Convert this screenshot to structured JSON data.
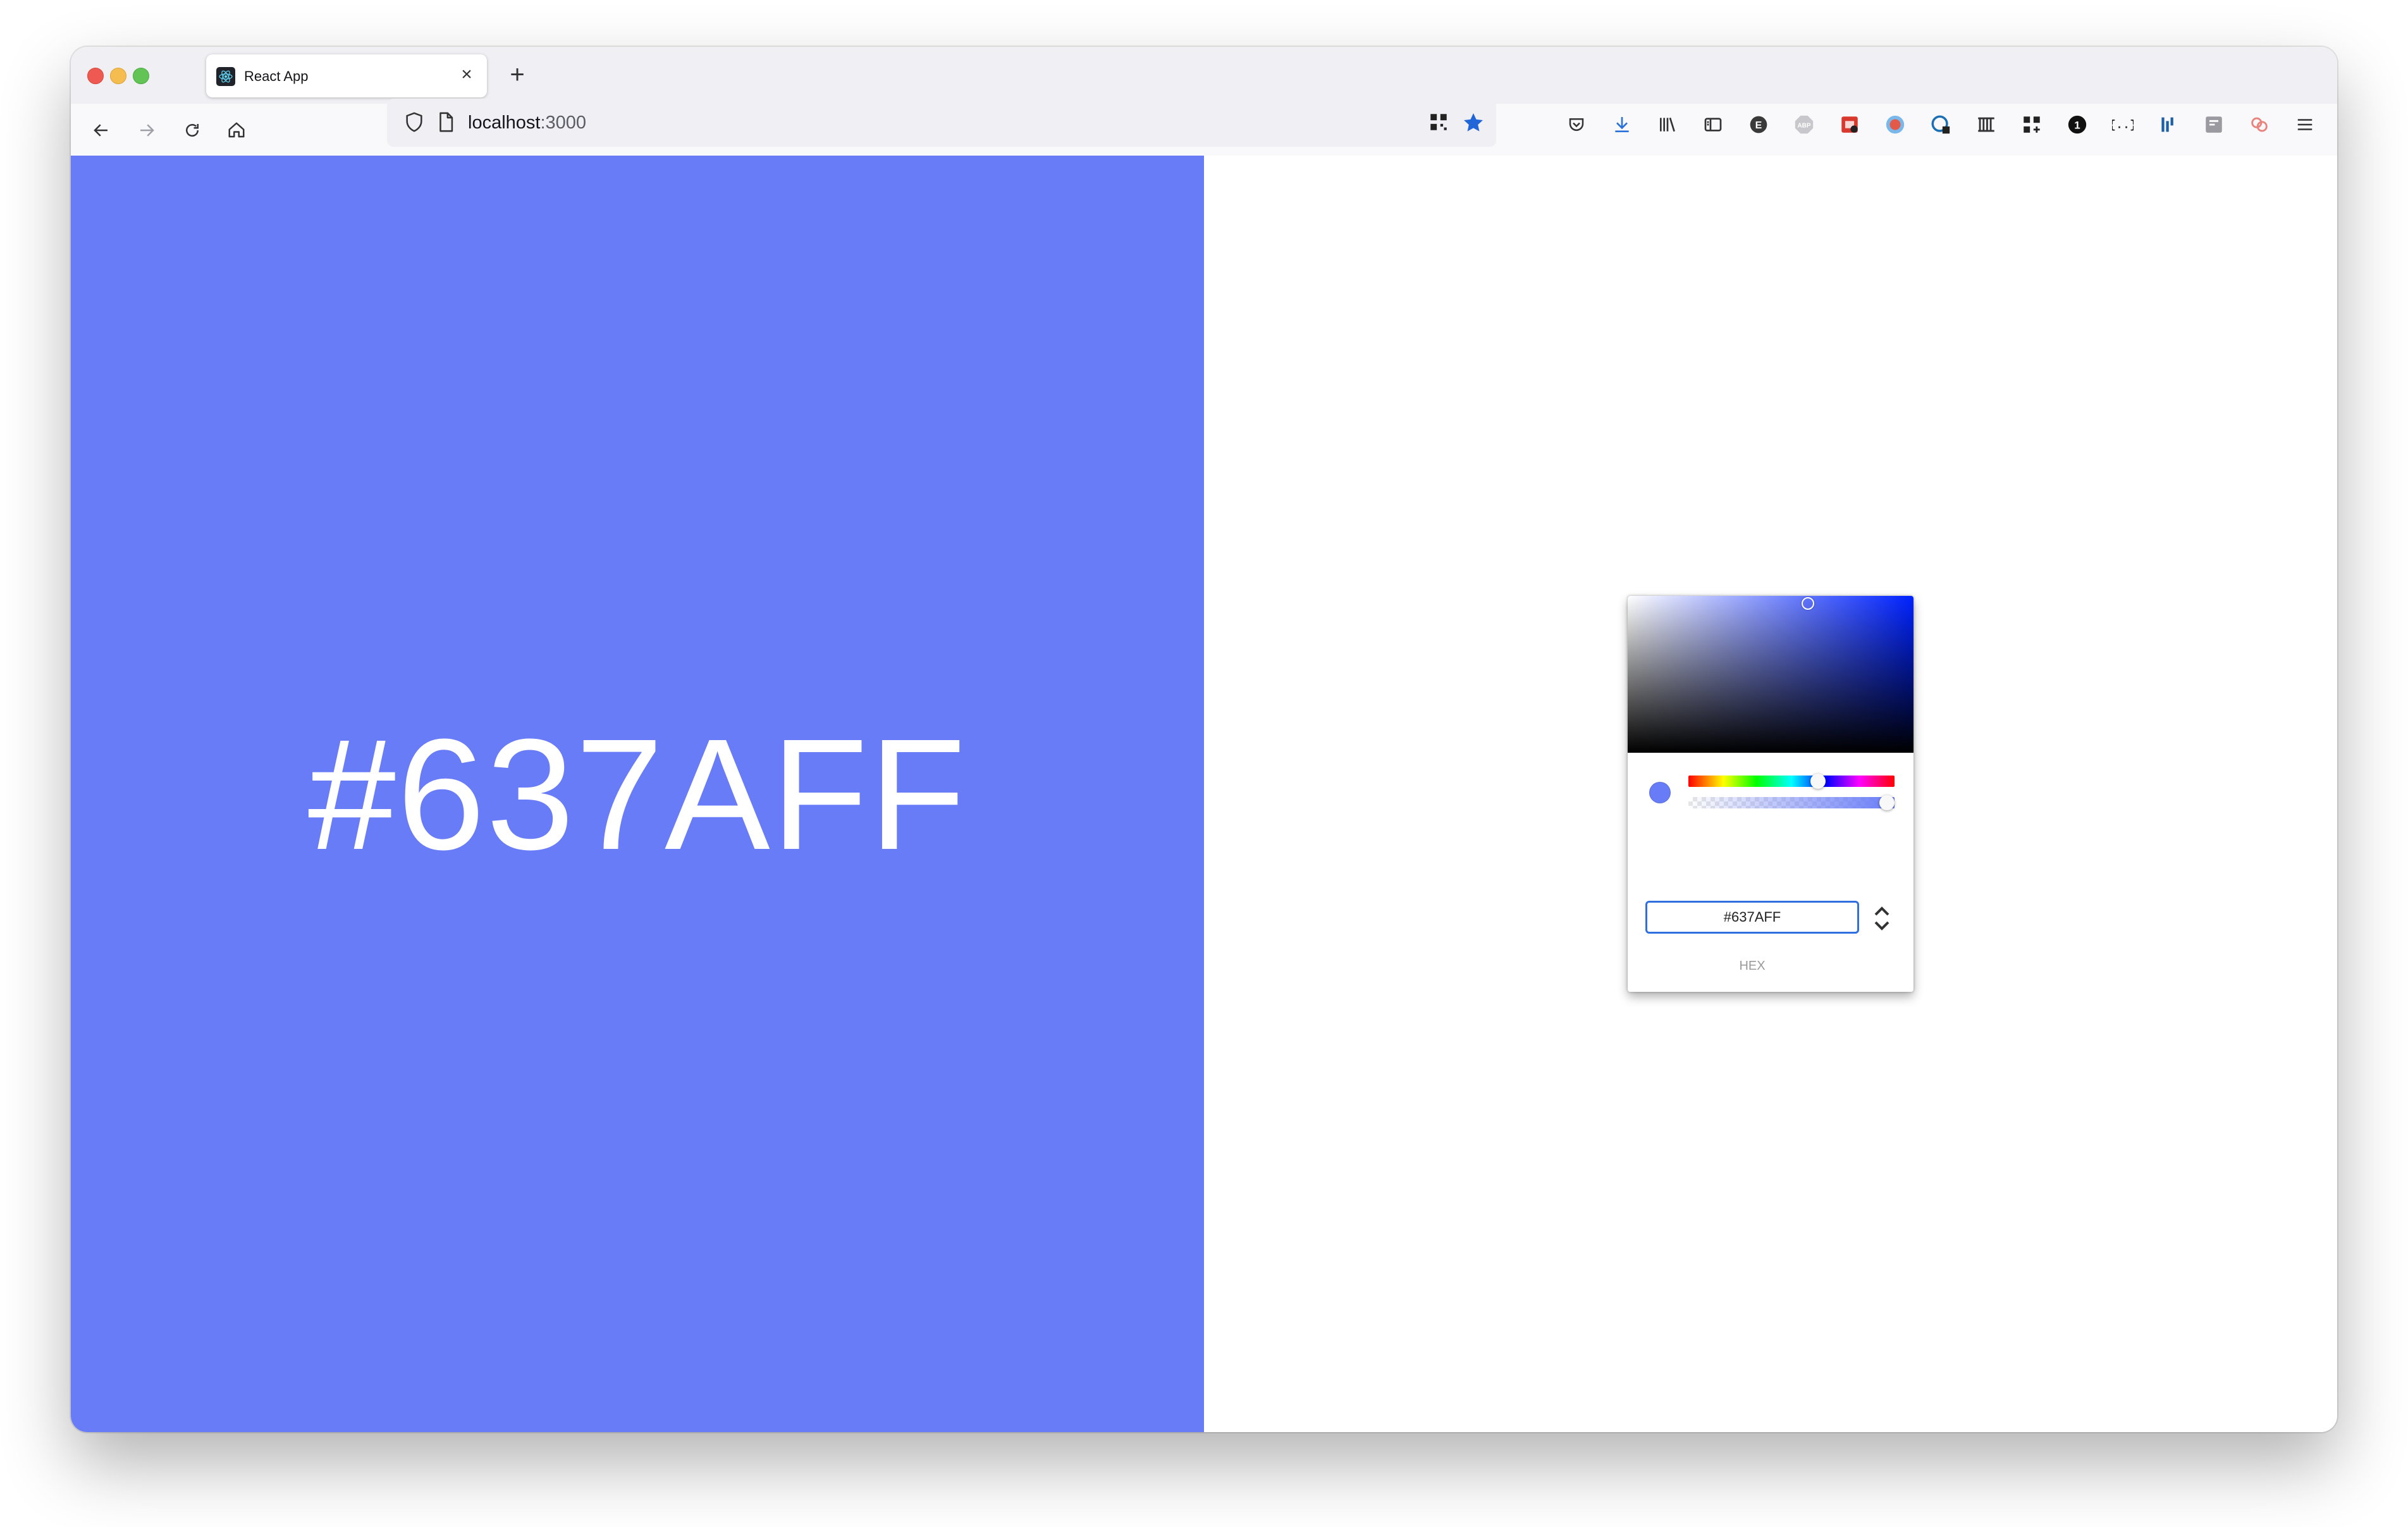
{
  "browser": {
    "tab": {
      "title": "React App",
      "close_glyph": "×",
      "favicon": "react-logo-icon"
    },
    "new_tab_glyph": "+",
    "nav": {
      "back": "arrow-left-icon",
      "forward": "arrow-right-icon",
      "reload": "reload-icon",
      "home": "home-icon"
    },
    "url": {
      "host": "localhost",
      "port": ":3000"
    }
  },
  "page": {
    "display_hex": "#637AFF",
    "background_color": "#687cf7",
    "text_color": "#ffffff"
  },
  "picker": {
    "hex_value": "#637AFF",
    "format_label": "HEX",
    "hue_level": 0.64,
    "alpha_level": 1.0,
    "selected_color": "#687cf7"
  }
}
